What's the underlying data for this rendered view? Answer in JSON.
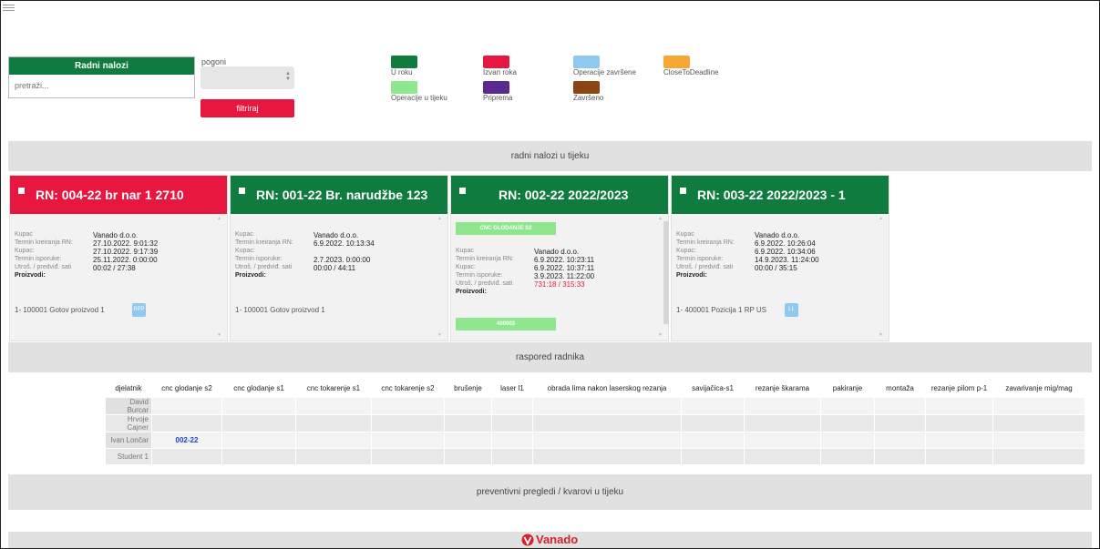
{
  "search_panel": {
    "title": "Radni nalozi",
    "placeholder": "pretraži..."
  },
  "filter": {
    "pogoni_label": "pogoni",
    "pogoni_value": "",
    "button_label": "filtriraj"
  },
  "legend": [
    {
      "label": "U roku",
      "color": "#0f7b3f"
    },
    {
      "label": "Operacije u tijeku",
      "color": "#8ee68d"
    },
    {
      "label": "Izvan roka",
      "color": "#e8173f"
    },
    {
      "label": "Priprema",
      "color": "#5a2a8e"
    },
    {
      "label": "Operacije završene",
      "color": "#8fc9ef"
    },
    {
      "label": "Završeno",
      "color": "#8b4513"
    },
    {
      "label": "CloseToDeadline",
      "color": "#f7a833"
    }
  ],
  "section_titles": {
    "in_progress": "radni nalozi u tijeku",
    "schedule": "raspored radnika",
    "maintenance": "preventivni pregledi / kvarovi u tijeku"
  },
  "field_labels": {
    "kupac": "Kupac",
    "termin_kreiranja": "Termin kreiranja RN:",
    "kupac2": "Kupac:",
    "termin_isporuke": "Termin isporuke:",
    "utroseno": "Utroš. / predviđ. sati",
    "proizvodi": "Proizvodi:"
  },
  "cards": [
    {
      "title": "RN: 004-22 br nar 1 2710",
      "status_color": "#e8173f",
      "kupac": "Vanado d.o.o.",
      "termin_kreiranja": "27.10.2022. 9:01:32",
      "kupac_date": "27.10.2022. 9:17:39",
      "termin_isporuke": "25.11.2022. 0:00:00",
      "utroseno": "00:02 / 27:38",
      "product": "1-   100001 Gotov proizvod 1",
      "tag": "RPP"
    },
    {
      "title": "RN: 001-22 Br. narudžbe 123",
      "status_color": "#0f7b3f",
      "kupac": "Vanado d.o.o.",
      "termin_kreiranja": "6.9.2022. 10:13:34",
      "kupac_date": "",
      "termin_isporuke": "2.7.2023. 0:00:00",
      "utroseno": "00:00 / 44:11",
      "product": "1-   100001 Gotov proizvod 1",
      "tag": ""
    },
    {
      "title": "RN: 002-22 2022/2023",
      "status_color": "#0f7b3f",
      "operation": "CNC GLODANJE S2",
      "kupac": "Vanado d.o.o.",
      "termin_kreiranja": "6.9.2022. 10:23:11",
      "kupac_date": "6.9.2022. 10:37:11",
      "termin_isporuke": "3.9.2023. 11:22:00",
      "utroseno": "731:18 / 315:33",
      "product_code": "400003"
    },
    {
      "title": "RN: 003-22 2022/2023 - 1",
      "status_color": "#0f7b3f",
      "kupac": "Vanado d.o.o.",
      "termin_kreiranja": "6.9.2022. 10:26:04",
      "kupac_date": "6.9.2022. 10:34:06",
      "termin_isporuke": "14.9.2023. 11:24:00",
      "utroseno": "00:00 / 35:15",
      "product": "1-   400001 Pozicija 1 RP US",
      "tag": "I.I."
    }
  ],
  "schedule": {
    "columns": [
      "djelatnik",
      "cnc glodanje s2",
      "cnc glodanje s1",
      "cnc tokarenje s1",
      "cnc tokarenje s2",
      "brušenje",
      "laser l1",
      "obrada lima nakon laserskog rezanja",
      "savijačica-s1",
      "rezanje škarama",
      "pakiranje",
      "montaža",
      "rezanje pilom p-1",
      "zavarivanje mig/mag"
    ],
    "rows": [
      {
        "name": "David Burcar",
        "cells": [
          "",
          "",
          "",
          "",
          "",
          "",
          "",
          "",
          "",
          "",
          "",
          "",
          ""
        ]
      },
      {
        "name": "Hrvoje Cajner",
        "cells": [
          "",
          "",
          "",
          "",
          "",
          "",
          "",
          "",
          "",
          "",
          "",
          "",
          ""
        ]
      },
      {
        "name": "Ivan Lončar",
        "cells": [
          "002-22",
          "",
          "",
          "",
          "",
          "",
          "",
          "",
          "",
          "",
          "",
          "",
          ""
        ]
      },
      {
        "name": "Student 1",
        "cells": [
          "",
          "",
          "",
          "",
          "",
          "",
          "",
          "",
          "",
          "",
          "",
          "",
          ""
        ]
      }
    ]
  },
  "footer": {
    "brand": "Vanado",
    "brand_color": "#d3232b"
  }
}
